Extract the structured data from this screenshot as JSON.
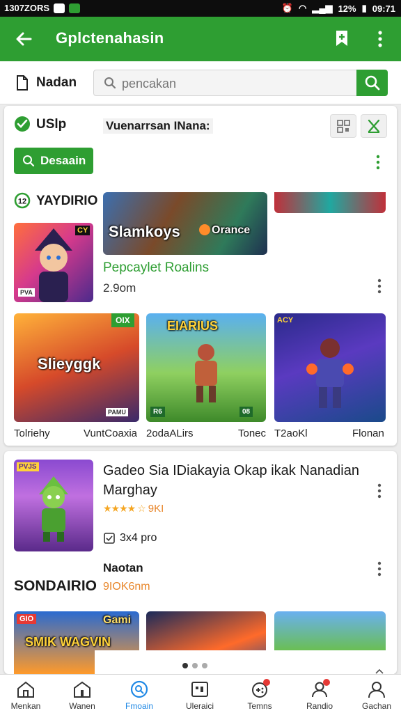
{
  "status_bar": {
    "left_text": "1307ZORS",
    "right_text": "12%",
    "time": "09:71"
  },
  "app_bar": {
    "title": "Gplctenahasin",
    "back_icon": "arrow-left-icon",
    "bookmark_icon": "bookmark-add-icon",
    "menu_icon": "more-vertical-icon"
  },
  "search": {
    "section_label": "Nadan",
    "placeholder": "pencakan",
    "button_icon": "search-icon"
  },
  "card1": {
    "check_label": "USlp",
    "filter_label": "Vuenarrsan INana:",
    "desain_button": "Desaain",
    "section_title": "YAYDIRIO",
    "banner_title_left": "Slamkoys",
    "banner_title_right": "Orance",
    "featured_title": "Pepcaylet Roalins",
    "featured_meta": "2.9om",
    "hero_badge": "CY",
    "hero_tag": "PVA",
    "grid": [
      {
        "title": "Slieyggk",
        "badge": "OIX",
        "caption": "Tolriehy",
        "corner": "PAMU"
      },
      {
        "title": "EIARIUS",
        "badge": "08",
        "caption": "VuntCoaxia",
        "corner": "R6"
      },
      {
        "title": "",
        "badge": "ACY",
        "caption": "Tonec",
        "corner": ""
      }
    ],
    "grid_captions": [
      "Tolriehy",
      "VuntCoaxia",
      "2odaALirs",
      "Tonec",
      "T2aoKl",
      "Flonan"
    ]
  },
  "card2": {
    "app_title": "Gadeo Sia IDiakayia Okap ikak Nanadian Marghay",
    "rating_text": "9KI",
    "rating_value": 4.5,
    "size_text": "3x4 pro",
    "sub_label": "Naotan",
    "section_title": "SONDAIRIO",
    "section_meta": "9IOK6nm",
    "thumb_badge_1": "GIO",
    "thumb_title_1": "Gami",
    "thumb_text_1": "SMIK WAGVIN"
  },
  "pager": {
    "count": 3,
    "active": 0
  },
  "bottom_nav": [
    {
      "label": "Menkan",
      "icon": "home-icon",
      "badge": false,
      "active": false
    },
    {
      "label": "Wanen",
      "icon": "store-icon",
      "badge": false,
      "active": false
    },
    {
      "label": "Fmoain",
      "icon": "search-circle-icon",
      "badge": false,
      "active": true
    },
    {
      "label": "Uleraici",
      "icon": "library-icon",
      "badge": false,
      "active": false
    },
    {
      "label": "Temns",
      "icon": "game-controller-icon",
      "badge": true,
      "active": false
    },
    {
      "label": "Randio",
      "icon": "account-group-icon",
      "badge": true,
      "active": false
    },
    {
      "label": "Gachan",
      "icon": "person-icon",
      "badge": false,
      "active": false
    }
  ],
  "colors": {
    "primary": "#2e9e32",
    "text": "#1a1a1a",
    "star": "#f5a623",
    "meta_orange": "#e8862a"
  }
}
